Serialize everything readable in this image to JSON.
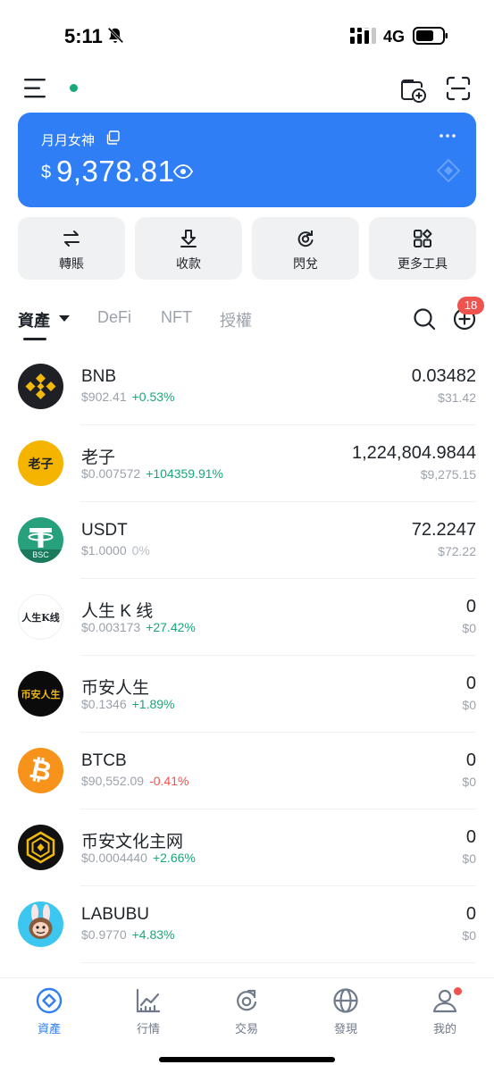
{
  "status_bar": {
    "time": "5:11",
    "network": "4G"
  },
  "header": {
    "icons": [
      "menu-icon",
      "wallet-add-icon",
      "scan-icon"
    ],
    "online_color": "#17a87a"
  },
  "wallet": {
    "name": "月月女神",
    "currency_symbol": "$",
    "balance": "9,378.81",
    "card_color": "#2f7ef6"
  },
  "actions": [
    {
      "label": "轉賬",
      "icon": "transfer-icon"
    },
    {
      "label": "收款",
      "icon": "receive-icon"
    },
    {
      "label": "閃兌",
      "icon": "swap-icon"
    },
    {
      "label": "更多工具",
      "icon": "tools-icon"
    }
  ],
  "tabs": [
    {
      "label": "資產",
      "active": true
    },
    {
      "label": "DeFi"
    },
    {
      "label": "NFT"
    },
    {
      "label": "授權"
    }
  ],
  "notification_count": "18",
  "tokens": [
    {
      "name": "BNB",
      "price": "$902.41",
      "change": "+0.53%",
      "direction": "up",
      "amount": "0.03482",
      "value": "$31.42",
      "logo_text": ""
    },
    {
      "name": "老子",
      "price": "$0.007572",
      "change": "+104359.91%",
      "direction": "up",
      "amount": "1,224,804.9844",
      "value": "$9,275.15",
      "logo_text": "老子"
    },
    {
      "name": "USDT",
      "price": "$1.0000",
      "change": "0%",
      "direction": "flat",
      "amount": "72.2247",
      "value": "$72.22",
      "logo_text": "BSC"
    },
    {
      "name": "人生 K 线",
      "price": "$0.003173",
      "change": "+27.42%",
      "direction": "up",
      "amount": "0",
      "value": "$0",
      "logo_text": "人生K线"
    },
    {
      "name": "币安人生",
      "price": "$0.1346",
      "change": "+1.89%",
      "direction": "up",
      "amount": "0",
      "value": "$0",
      "logo_text": "币安人生"
    },
    {
      "name": "BTCB",
      "price": "$90,552.09",
      "change": "-0.41%",
      "direction": "down",
      "amount": "0",
      "value": "$0",
      "logo_text": ""
    },
    {
      "name": "币安文化主网",
      "price": "$0.0004440",
      "change": "+2.66%",
      "direction": "up",
      "amount": "0",
      "value": "$0",
      "logo_text": ""
    },
    {
      "name": "LABUBU",
      "price": "$0.9770",
      "change": "+4.83%",
      "direction": "up",
      "amount": "0",
      "value": "$0",
      "logo_text": ""
    }
  ],
  "bottom_nav": [
    {
      "label": "資產",
      "active": true
    },
    {
      "label": "行情"
    },
    {
      "label": "交易"
    },
    {
      "label": "發現"
    },
    {
      "label": "我的"
    }
  ]
}
